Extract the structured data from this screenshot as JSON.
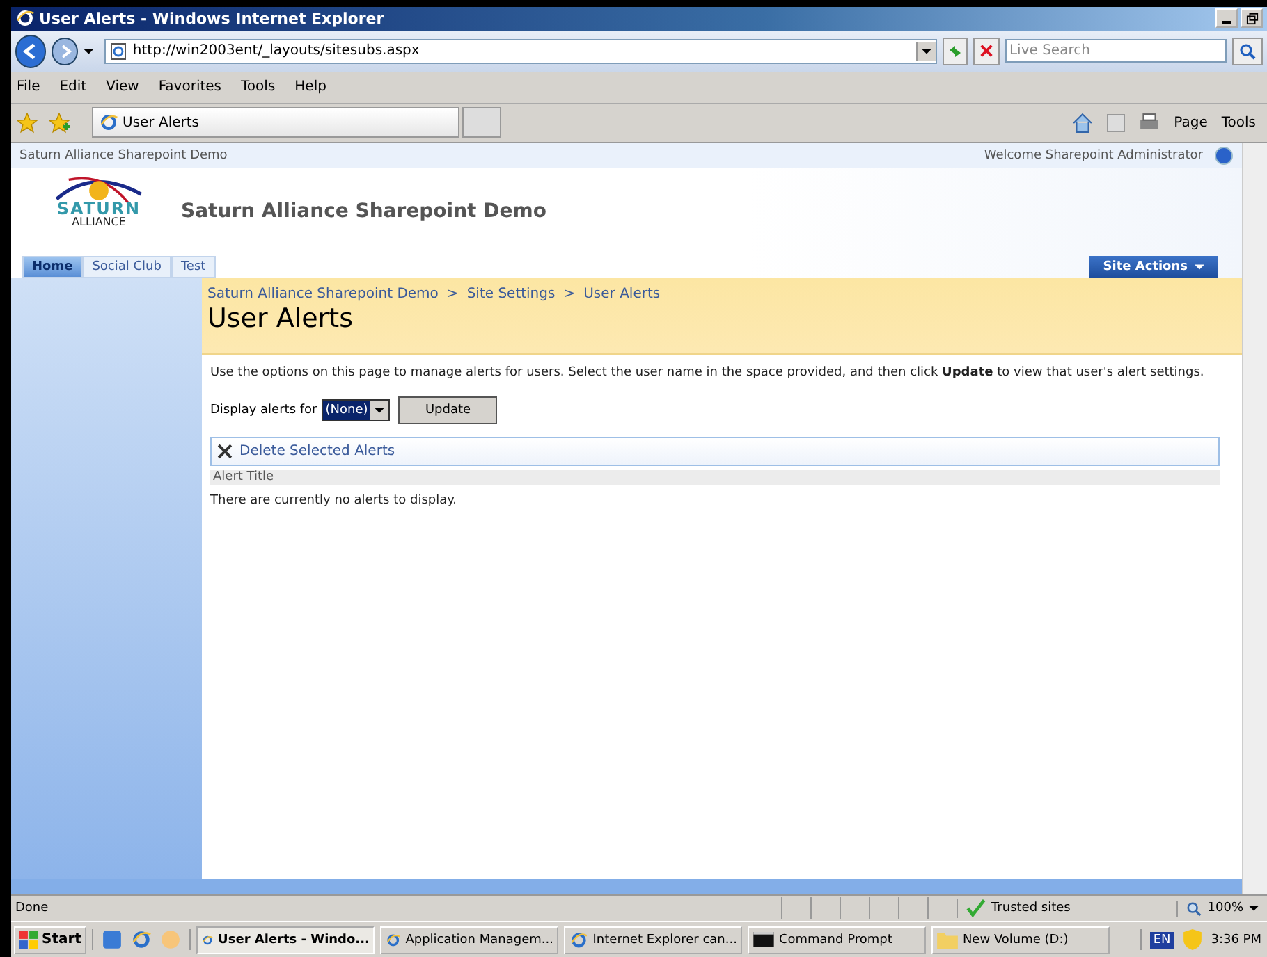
{
  "window": {
    "title": "User Alerts - Windows Internet Explorer"
  },
  "address_bar": {
    "url": "http://win2003ent/_layouts/sitesubs.aspx",
    "search_placeholder": "Live Search"
  },
  "menu": [
    "File",
    "Edit",
    "View",
    "Favorites",
    "Tools",
    "Help"
  ],
  "browser_tab": {
    "title": "User Alerts"
  },
  "command_bar": [
    "Page",
    "Tools"
  ],
  "site": {
    "top_title": "Saturn Alliance Sharepoint Demo",
    "welcome": "Welcome Sharepoint Administrator",
    "logo_word": "SATURN",
    "logo_sub": "ALLIANCE",
    "title": "Saturn Alliance Sharepoint Demo",
    "site_actions": "Site Actions"
  },
  "tabs": [
    {
      "label": "Home",
      "selected": true
    },
    {
      "label": "Social Club",
      "selected": false
    },
    {
      "label": "Test",
      "selected": false
    }
  ],
  "breadcrumb": [
    "Saturn Alliance Sharepoint Demo",
    "Site Settings",
    "User Alerts"
  ],
  "breadcrumb_separator": ">",
  "page_title": "User Alerts",
  "description": "Use the options on this page to manage alerts for users. Select the user name in the space provided, and then click **Update** to view that user's alert settings.",
  "filter": {
    "label": "Display alerts for",
    "value": "(None)",
    "button": "Update"
  },
  "toolbar": {
    "delete": "Delete Selected Alerts"
  },
  "table": {
    "columns": [
      "Alert Title"
    ],
    "empty_message": "There are currently no alerts to display."
  },
  "status_bar": {
    "status": "Done",
    "zone": "Trusted sites",
    "zoom": "100%"
  },
  "taskbar": {
    "start": "Start",
    "items": [
      {
        "label": "User Alerts - Windo...",
        "kind": "ie",
        "selected": true
      },
      {
        "label": "Application Managem...",
        "kind": "ie",
        "selected": false
      },
      {
        "label": "Internet Explorer can...",
        "kind": "ie",
        "selected": false
      },
      {
        "label": "Command Prompt",
        "kind": "cmd",
        "selected": false
      },
      {
        "label": "New Volume (D:)",
        "kind": "folder",
        "selected": false
      }
    ],
    "language": "EN",
    "clock": "3:36 PM"
  }
}
